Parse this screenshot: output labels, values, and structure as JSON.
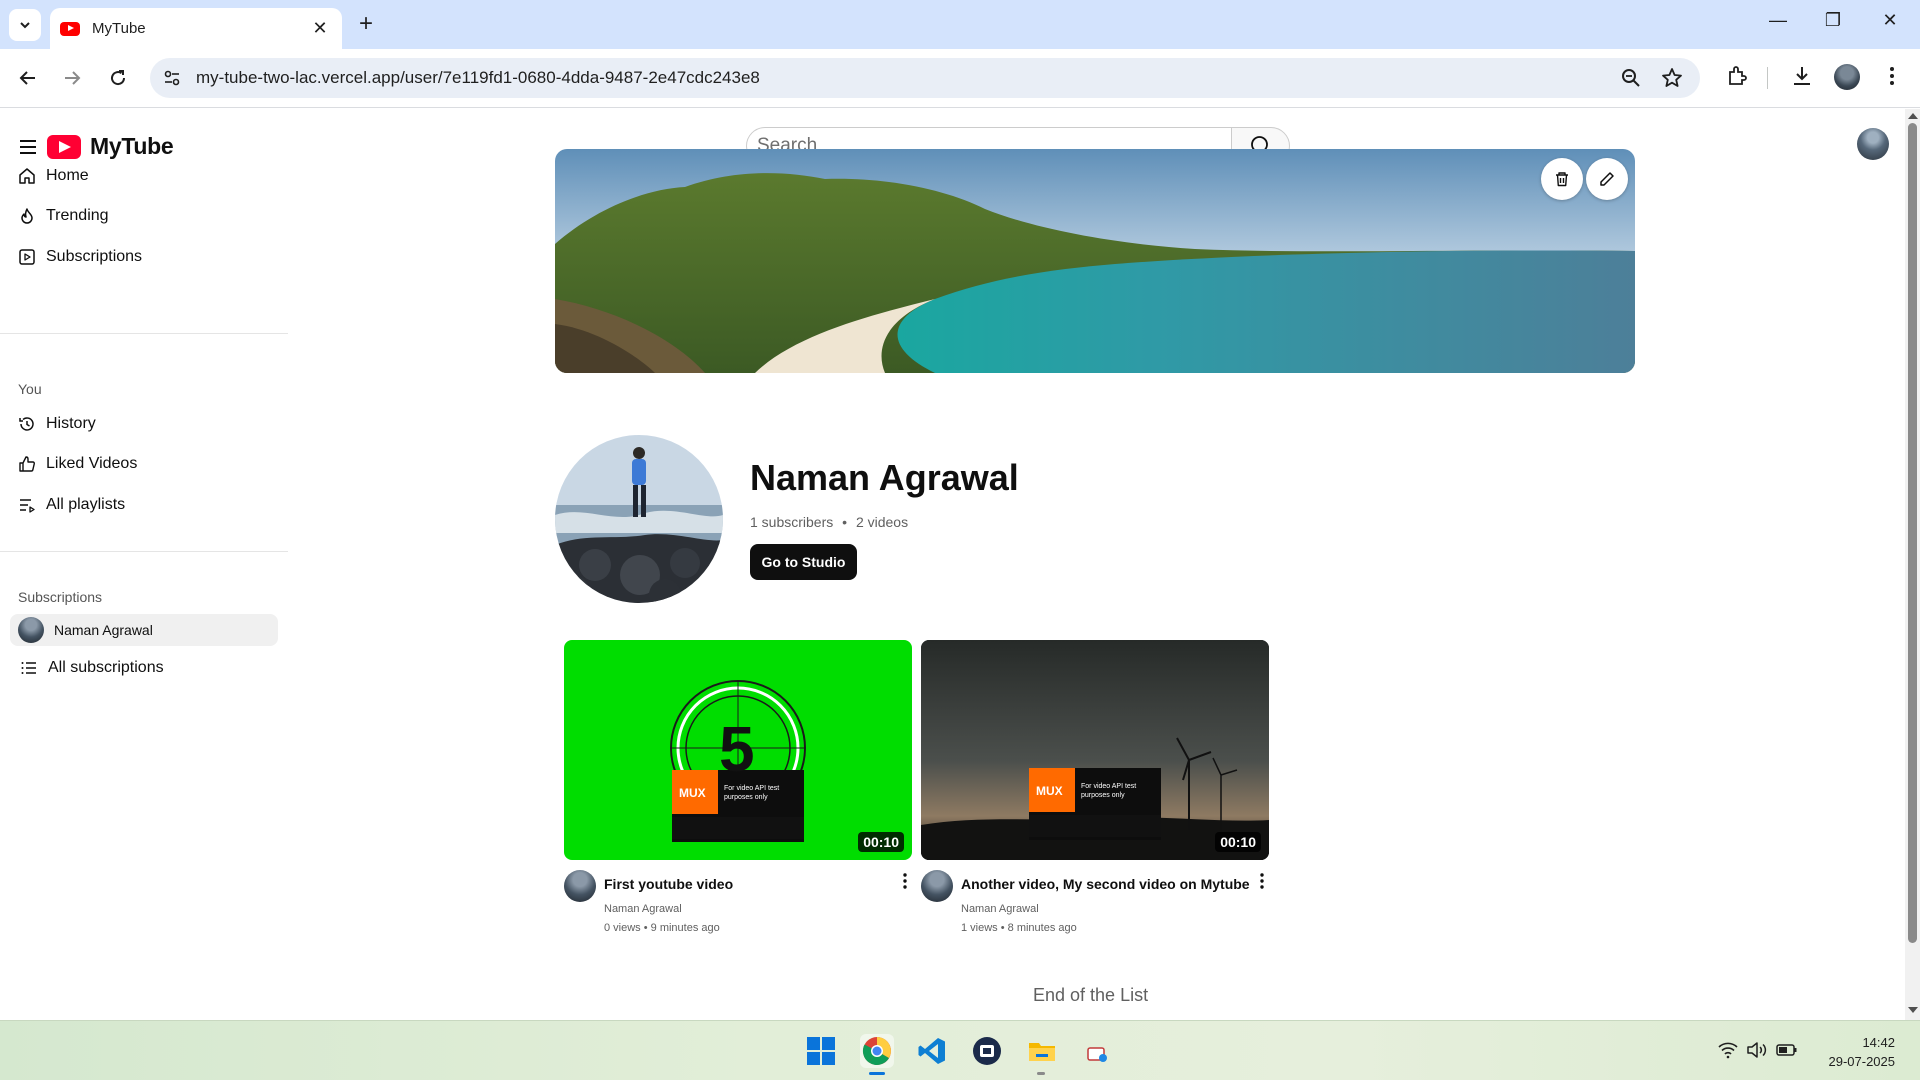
{
  "browser": {
    "tab_title": "MyTube",
    "url": "my-tube-two-lac.vercel.app/user/7e119fd1-0680-4dda-9487-2e47cdc243e8"
  },
  "app": {
    "name": "MyTube",
    "search_placeholder": "Search"
  },
  "sidebar": {
    "main_items": [
      {
        "label": "Home",
        "icon": "home-icon"
      },
      {
        "label": "Trending",
        "icon": "flame-icon"
      },
      {
        "label": "Subscriptions",
        "icon": "play-square-icon"
      }
    ],
    "you_heading": "You",
    "you_items": [
      {
        "label": "History",
        "icon": "history-icon"
      },
      {
        "label": "Liked Videos",
        "icon": "thumbs-up-icon"
      },
      {
        "label": "All playlists",
        "icon": "list-video-icon"
      }
    ],
    "subscriptions_heading": "Subscriptions",
    "subscriptions": [
      {
        "label": "Naman Agrawal"
      }
    ],
    "all_subscriptions_label": "All subscriptions"
  },
  "channel": {
    "name": "Naman Agrawal",
    "subscribers": "1 subscribers",
    "videos_count": "2 videos",
    "studio_button": "Go to Studio"
  },
  "videos": [
    {
      "title": "First youtube video",
      "channel": "Naman Agrawal",
      "stats": "0 views • 9 minutes ago",
      "duration": "00:10",
      "thumb_text": "For video API test purposes only",
      "thumb_brand": "MUX",
      "thumb_number": "5"
    },
    {
      "title": "Another video, My second video on Mytube",
      "channel": "Naman Agrawal",
      "stats": "1 views • 8 minutes ago",
      "duration": "00:10",
      "thumb_text": "For video API test purposes only",
      "thumb_brand": "MUX"
    }
  ],
  "end_of_list": "End of the List",
  "taskbar": {
    "time": "14:42",
    "date": "29-07-2025"
  },
  "colors": {
    "brand_red": "#ff0033",
    "tabbar": "#d3e3fd",
    "green_screen": "#00dd00",
    "mux_orange": "#ff6a00"
  }
}
